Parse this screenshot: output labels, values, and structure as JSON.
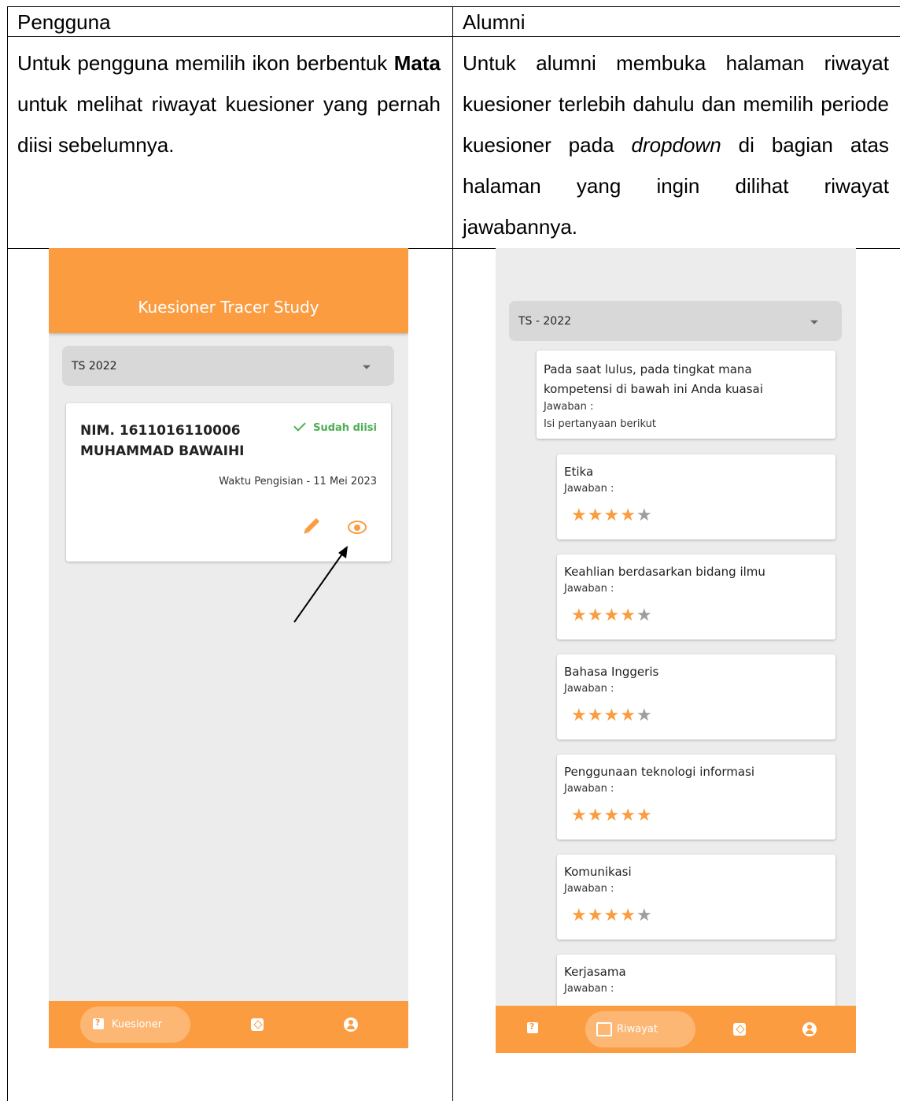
{
  "table": {
    "header_left": "Pengguna",
    "header_right": "Alumni",
    "left_desc": {
      "part1": "Untuk pengguna memilih ikon berbentuk ",
      "bold": "Mata",
      "part2": " untuk melihat riwayat kuesioner yang pernah diisi sebelumnya."
    },
    "right_desc": {
      "part1": "Untuk alumni membuka halaman riwayat kuesioner terlebih dahulu dan memilih periode kuesioner pada ",
      "italic": "dropdown",
      "part2": " di bagian atas halaman yang ingin dilihat riwayat jawabannya."
    }
  },
  "left_app": {
    "title": "Kuesioner Tracer Study",
    "dropdown_value": "TS 2022",
    "card": {
      "nim": "NIM. 1611016110006",
      "name": "MUHAMMAD BAWAIHI",
      "status": "Sudah diisi",
      "waktu": "Waktu Pengisian - 11 Mei 2023"
    },
    "nav": {
      "active_label": "Kuesioner"
    },
    "icons": [
      "pencil-icon",
      "eye-icon",
      "questionnaire-icon",
      "clipboard-icon",
      "account-icon"
    ],
    "colors": {
      "primary": "#fb9c40",
      "success": "#4caf50"
    }
  },
  "right_app": {
    "dropdown_value": "TS - 2022",
    "intro": {
      "title": "Pada saat lulus, pada tingkat mana kompetensi di bawah ini Anda kuasai",
      "label": "Jawaban :",
      "answer": "Isi pertanyaan berikut"
    },
    "items": [
      {
        "title": "Etika",
        "label": "Jawaban :",
        "rating": 4,
        "max": 5
      },
      {
        "title": "Keahlian berdasarkan bidang ilmu",
        "label": "Jawaban :",
        "rating": 4,
        "max": 5
      },
      {
        "title": "Bahasa Inggeris",
        "label": "Jawaban :",
        "rating": 4,
        "max": 5
      },
      {
        "title": "Penggunaan teknologi informasi",
        "label": "Jawaban :",
        "rating": 5,
        "max": 5
      },
      {
        "title": "Komunikasi",
        "label": "Jawaban :",
        "rating": 4,
        "max": 5
      },
      {
        "title": "Kerjasama",
        "label": "Jawaban :"
      }
    ],
    "nav": {
      "active_label": "Riwayat"
    },
    "icons": [
      "questionnaire-icon",
      "history-icon",
      "clipboard-icon",
      "account-icon"
    ]
  }
}
